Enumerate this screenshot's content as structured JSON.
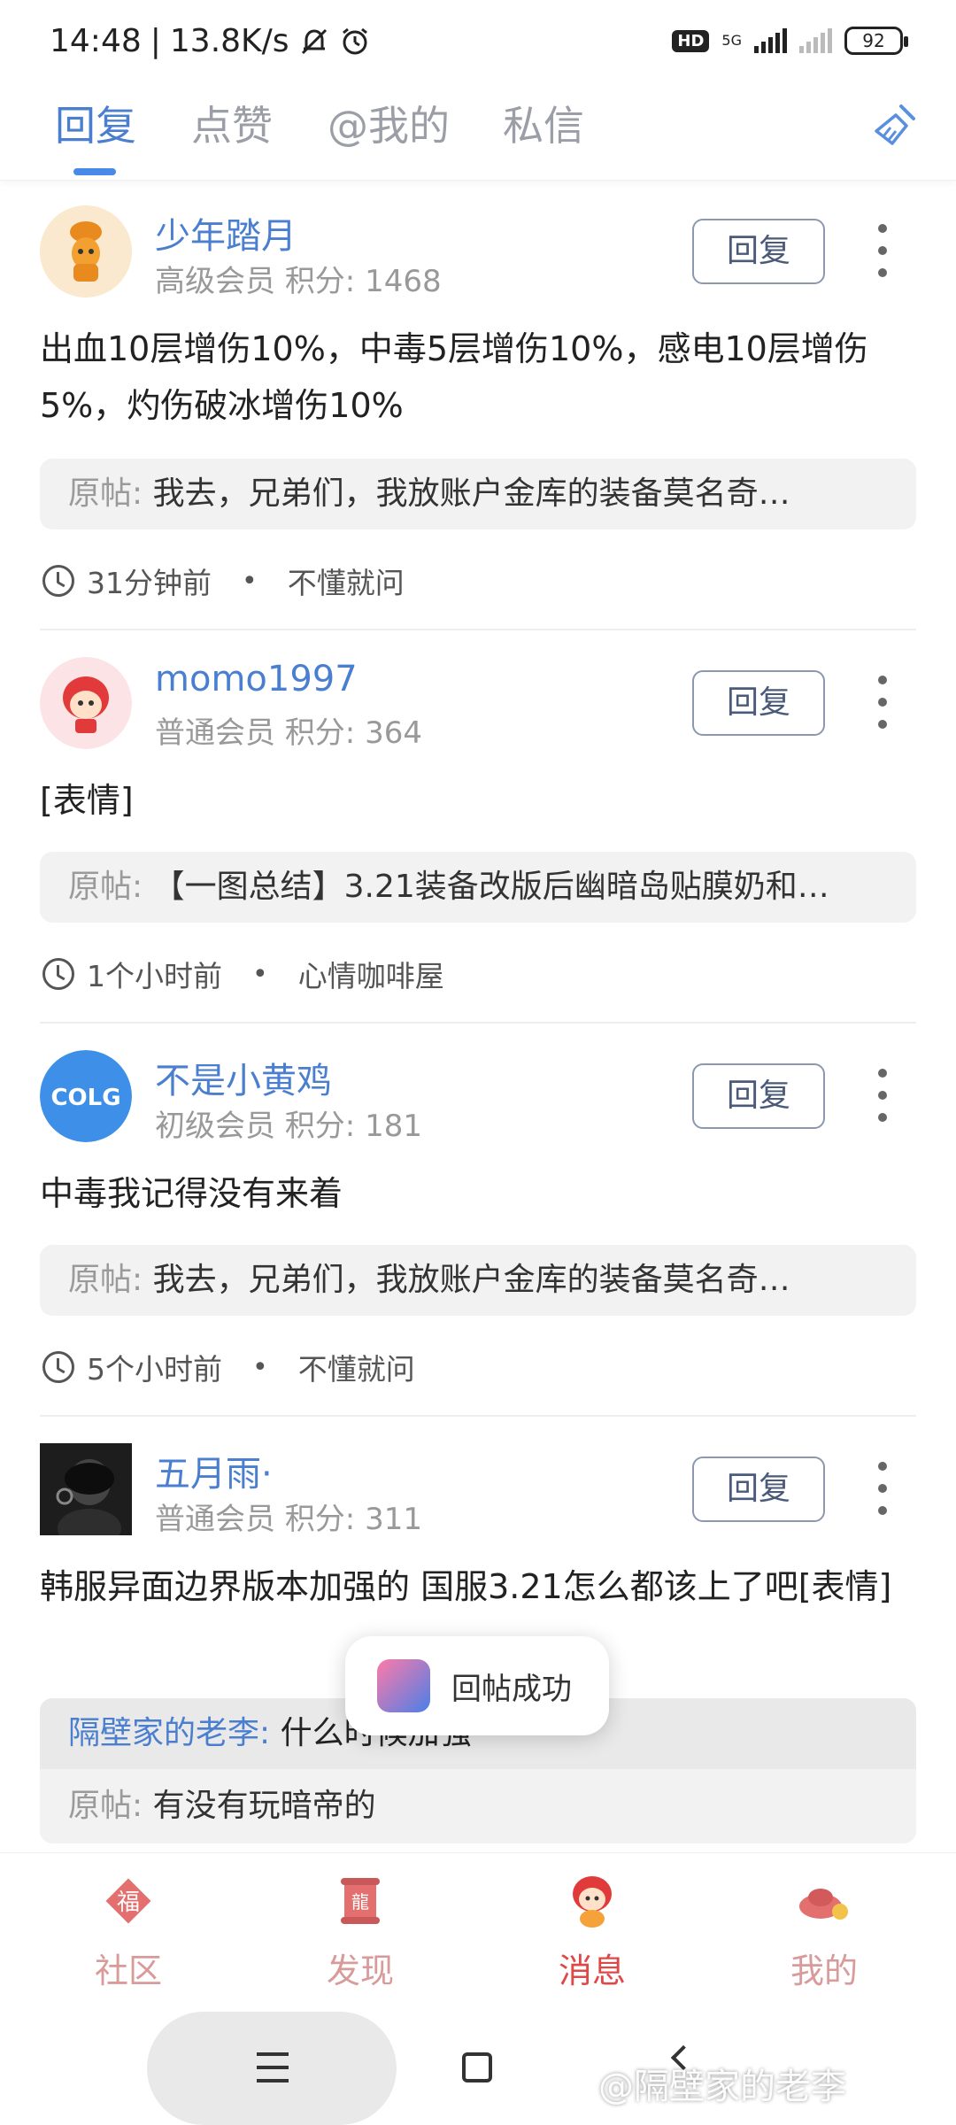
{
  "status_bar": {
    "time": "14:48",
    "speed": "13.8K/s",
    "network": "5G",
    "battery": "92"
  },
  "tabs": [
    {
      "label": "回复",
      "active": true
    },
    {
      "label": "点赞",
      "active": false
    },
    {
      "label": "@我的",
      "active": false
    },
    {
      "label": "私信",
      "active": false
    }
  ],
  "feed": [
    {
      "username": "少年踏月",
      "level": "高级会员",
      "score": "积分: 1468",
      "reply_label": "回复",
      "content": "出血10层增伤10%，中毒5层增伤10%，感电10层增伤5%，灼伤破冰增伤10%",
      "quote_label": "原帖:",
      "quote_text": "我去，兄弟们，我放账户金库的装备莫名奇…",
      "time": "31分钟前",
      "forum": "不懂就问"
    },
    {
      "username": "momo1997",
      "level": "普通会员",
      "score": "积分: 364",
      "reply_label": "回复",
      "content": "[表情]",
      "quote_label": "原帖:",
      "quote_text": "【一图总结】3.21装备改版后幽暗岛贴膜奶和…",
      "time": "1个小时前",
      "forum": "心情咖啡屋"
    },
    {
      "username": "不是小黄鸡",
      "level": "初级会员",
      "score": "积分: 181",
      "reply_label": "回复",
      "content": "中毒我记得没有来着",
      "quote_label": "原帖:",
      "quote_text": "我去，兄弟们，我放账户金库的装备莫名奇…",
      "time": "5个小时前",
      "forum": "不懂就问"
    },
    {
      "username": "五月雨·",
      "level": "普通会员",
      "score": "积分: 311",
      "reply_label": "回复",
      "content": "韩服异面边界版本加强的 国服3.21怎么都该上了吧[表情]",
      "reply_to_name": "隔壁家的老李:",
      "reply_to_text": "什么时候加强",
      "quote_label": "原帖:",
      "quote_text": "有没有玩暗帝的"
    }
  ],
  "toast": "回帖成功",
  "bottom_nav": [
    {
      "label": "社区",
      "icon": "fu-icon"
    },
    {
      "label": "发现",
      "icon": "dragon-scroll-icon"
    },
    {
      "label": "消息",
      "icon": "mascot-icon",
      "active": true
    },
    {
      "label": "我的",
      "icon": "gold-ingot-icon"
    }
  ],
  "watermark": "@隔壁家的老李",
  "colors": {
    "accent": "#4a7fd0",
    "nav_active": "#e04848",
    "nav_inactive": "#d99a9a"
  }
}
